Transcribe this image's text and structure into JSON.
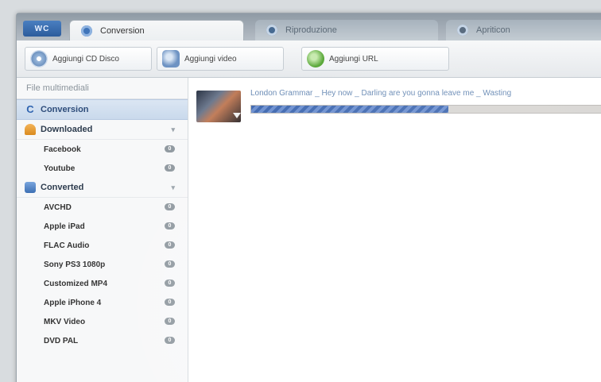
{
  "app": {
    "logo_text": "WC"
  },
  "tabs": [
    {
      "label": "Conversion",
      "icon": "convert-icon",
      "active": true
    },
    {
      "label": "Riproduzione",
      "icon": "play-icon",
      "active": false
    },
    {
      "label": "Apriticon",
      "icon": "gear-icon",
      "active": false
    }
  ],
  "toolbar": {
    "add_cd": "Aggiungi CD Disco",
    "add_video": "Aggiungi video",
    "add_url": "Aggiungi URL"
  },
  "sidebar": {
    "heading": "File multimediali",
    "selected": "Conversion",
    "groups": [
      {
        "label": "Downloaded",
        "items": [
          {
            "label": "Facebook",
            "count": "0"
          },
          {
            "label": "Youtube",
            "count": "0"
          }
        ]
      },
      {
        "label": "Converted",
        "items": [
          {
            "label": "AVCHD",
            "count": "0"
          },
          {
            "label": "Apple iPad",
            "count": "0"
          },
          {
            "label": "FLAC Audio",
            "count": "0"
          },
          {
            "label": "Sony PS3 1080p",
            "count": "0"
          },
          {
            "label": "Customized MP4",
            "count": "0"
          },
          {
            "label": "Apple iPhone 4",
            "count": "0"
          },
          {
            "label": "MKV Video",
            "count": "0"
          },
          {
            "label": "DVD PAL",
            "count": "0"
          }
        ]
      }
    ]
  },
  "main": {
    "items": [
      {
        "title": "London Grammar _ Hey now _ Darling are you gonna leave me _ Wasting",
        "progress": 0.55
      }
    ]
  },
  "colors": {
    "accent": "#3f68b0",
    "selected_bg": "#c9d9ec"
  }
}
